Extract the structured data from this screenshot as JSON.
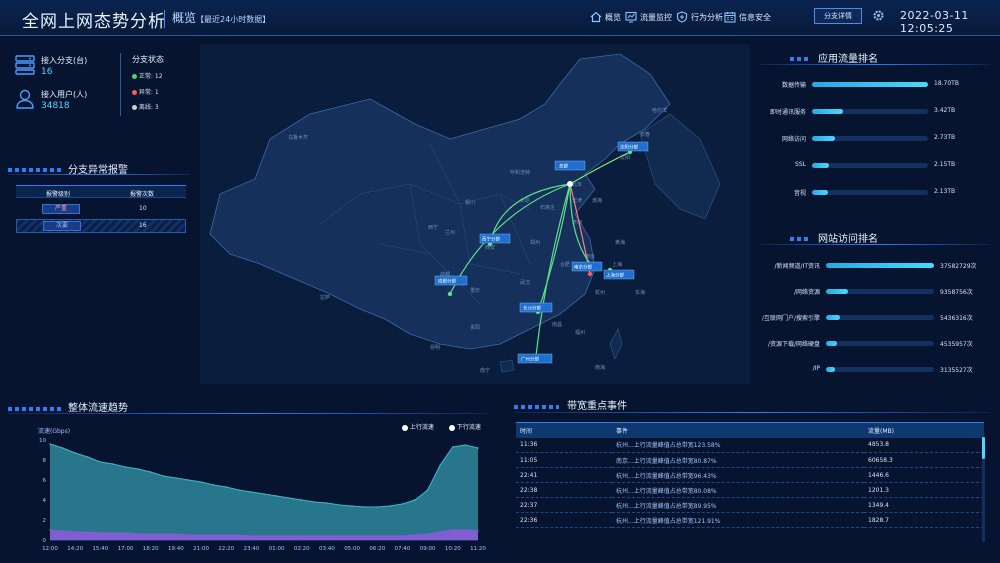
{
  "header": {
    "title": "全网上网态势分析",
    "subtitle": "概览",
    "subtitle_note": "【最近24小时数据】",
    "nav": [
      {
        "label": "概览",
        "icon": "home-icon"
      },
      {
        "label": "流量监控",
        "icon": "monitor-icon"
      },
      {
        "label": "行为分析",
        "icon": "shield-icon"
      },
      {
        "label": "信息安全",
        "icon": "calendar-icon"
      }
    ],
    "detail_button": "分支详情",
    "datetime": "2022-03-11 12:05:25"
  },
  "summary": {
    "branches_label": "接入分支(台)",
    "branches_value": "16",
    "users_label": "接入用户(人)",
    "users_value": "34818",
    "status_title": "分支状态",
    "status": [
      {
        "label": "正常:",
        "value": "12",
        "color": "#3ddc6a"
      },
      {
        "label": "异常:",
        "value": "1",
        "color": "#ff5a5a"
      },
      {
        "label": "离线:",
        "value": "3",
        "color": "#cfcfcf"
      }
    ]
  },
  "alarms": {
    "title": "分支异常报警",
    "headers": [
      "报警级别",
      "报警次数"
    ],
    "rows": [
      {
        "level": "严重",
        "count": "10"
      },
      {
        "level": "次要",
        "count": "16"
      }
    ]
  },
  "app_rank": {
    "title": "应用流量排名",
    "items": [
      {
        "label": "数据传输",
        "value": "18.70TB",
        "fraction": 1.0
      },
      {
        "label": "即时通讯服务",
        "value": "3.42TB",
        "fraction": 0.27
      },
      {
        "label": "网络访问",
        "value": "2.73TB",
        "fraction": 0.2
      },
      {
        "label": "SSL",
        "value": "2.15TB",
        "fraction": 0.15
      },
      {
        "label": "音视",
        "value": "2.13TB",
        "fraction": 0.14
      }
    ]
  },
  "site_rank": {
    "title": "网站访问排名",
    "items": [
      {
        "label": "/新闻频道/IT资讯",
        "value": "37582729次",
        "fraction": 1.0
      },
      {
        "label": "/网络资源",
        "value": "9358756次",
        "fraction": 0.2
      },
      {
        "label": "/互联网门户/搜索引擎",
        "value": "5436316次",
        "fraction": 0.13
      },
      {
        "label": "/资源下载/网络硬盘",
        "value": "4535957次",
        "fraction": 0.1
      },
      {
        "label": "/IP",
        "value": "3135527次",
        "fraction": 0.08
      }
    ]
  },
  "trend": {
    "title": "整体流速趋势",
    "unit_label": "流速(Gbps)",
    "legend_up": "上行流速",
    "legend_down": "下行流速",
    "colors": {
      "up": "#3fb8c8",
      "down": "#8a5bd8"
    }
  },
  "events": {
    "title": "带宽重点事件",
    "headers": [
      "时间",
      "事件",
      "流量(MB)"
    ],
    "rows": [
      {
        "time": "11:36",
        "event": "杭州...上行流量峰值占总带宽123.58%",
        "flow": "4853.8"
      },
      {
        "time": "11:05",
        "event": "南京...上行流量峰值占总带宽80.87%",
        "flow": "60658.3"
      },
      {
        "time": "22:41",
        "event": "杭州...上行流量峰值占总带宽96.43%",
        "flow": "1446.6"
      },
      {
        "time": "22:38",
        "event": "杭州...上行流量峰值占总带宽80.08%",
        "flow": "1201.3"
      },
      {
        "time": "22:37",
        "event": "杭州...上行流量峰值占总带宽89.95%",
        "flow": "1349.4"
      },
      {
        "time": "22:36",
        "event": "杭州...上行流量峰值占总带宽121.91%",
        "flow": "1828.7"
      }
    ]
  },
  "map": {
    "places": [
      "乌鲁木齐",
      "西宁",
      "兰州",
      "银川",
      "呼和浩特",
      "北京",
      "石家庄",
      "太原",
      "天津",
      "济南",
      "沈阳",
      "长春",
      "哈尔滨",
      "郑州",
      "西安",
      "合肥",
      "南京",
      "上海",
      "杭州",
      "成都",
      "重庆",
      "武汉",
      "长沙",
      "贵阳",
      "昆明",
      "南宁",
      "广州",
      "福州",
      "南昌",
      "拉萨",
      "渤海",
      "黄海",
      "东海",
      "南海"
    ],
    "branches": [
      "总部",
      "沈阳分部",
      "西宁分部",
      "成都分部",
      "南京分部",
      "上海分部",
      "长沙分部",
      "广州分部"
    ],
    "hub": "北京"
  },
  "chart_data": {
    "type": "area",
    "title": "整体流速趋势",
    "xlabel": "",
    "ylabel": "流速(Gbps)",
    "ylim": [
      0,
      10
    ],
    "categories": [
      "12:00",
      "13:00",
      "14:20",
      "15:00",
      "15:40",
      "16:20",
      "17:00",
      "17:40",
      "18:20",
      "19:00",
      "19:40",
      "20:20",
      "21:00",
      "21:40",
      "22:20",
      "23:00",
      "23:40",
      "00:20",
      "01:00",
      "01:40",
      "02:20",
      "03:00",
      "03:40",
      "04:20",
      "05:00",
      "05:40",
      "06:20",
      "07:00",
      "07:40",
      "08:20",
      "09:00",
      "09:40",
      "10:20",
      "11:00",
      "11:20"
    ],
    "series": [
      {
        "name": "上行流速",
        "values": [
          9.6,
          9.2,
          8.7,
          8.3,
          7.8,
          7.6,
          7.3,
          7.1,
          6.8,
          6.4,
          6.2,
          6.0,
          5.8,
          5.5,
          5.3,
          5.0,
          4.8,
          4.6,
          4.4,
          4.2,
          4.0,
          3.8,
          3.7,
          3.5,
          3.4,
          3.3,
          3.3,
          3.4,
          3.6,
          4.0,
          5.0,
          7.5,
          9.3,
          9.5,
          9.2
        ]
      },
      {
        "name": "下行流速",
        "values": [
          1.0,
          0.9,
          0.8,
          0.8,
          0.7,
          0.7,
          0.7,
          0.6,
          0.6,
          0.6,
          0.6,
          0.5,
          0.5,
          0.5,
          0.5,
          0.5,
          0.4,
          0.4,
          0.4,
          0.4,
          0.4,
          0.4,
          0.4,
          0.4,
          0.4,
          0.4,
          0.4,
          0.4,
          0.4,
          0.5,
          0.6,
          0.8,
          1.0,
          1.0,
          0.9
        ]
      }
    ],
    "legend": "top-right",
    "grid": false
  }
}
